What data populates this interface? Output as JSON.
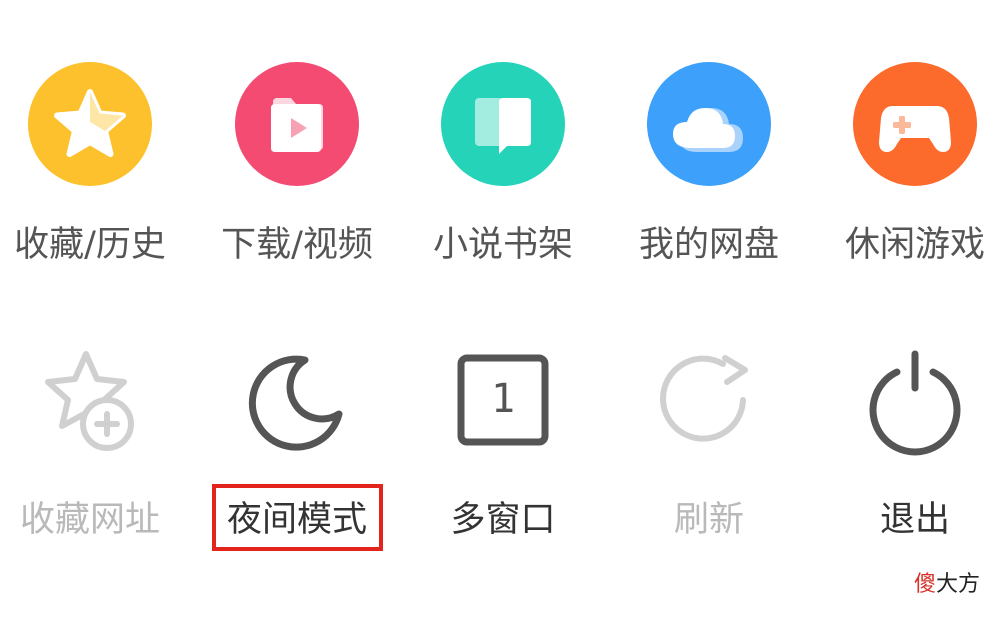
{
  "menu": {
    "row1": [
      {
        "label": "收藏/历史",
        "icon": "star-icon",
        "color": "#fcc12d"
      },
      {
        "label": "下载/视频",
        "icon": "video-folder-icon",
        "color": "#f44b73"
      },
      {
        "label": "小说书架",
        "icon": "book-icon",
        "color": "#25d3b9"
      },
      {
        "label": "我的网盘",
        "icon": "cloud-icon",
        "color": "#3da0fb"
      },
      {
        "label": "休闲游戏",
        "icon": "gamepad-icon",
        "color": "#fc6a2c"
      }
    ],
    "row2": [
      {
        "label": "收藏网址",
        "icon": "star-plus-icon",
        "state": "disabled"
      },
      {
        "label": "夜间模式",
        "icon": "moon-icon",
        "state": "highlighted"
      },
      {
        "label": "多窗口",
        "icon": "window-count-icon",
        "state": "enabled",
        "count": "1"
      },
      {
        "label": "刷新",
        "icon": "refresh-icon",
        "state": "disabled"
      },
      {
        "label": "退出",
        "icon": "power-icon",
        "state": "enabled"
      }
    ]
  },
  "highlight_color": "#e3241d",
  "watermark": {
    "first": "傻",
    "rest": "大方"
  }
}
